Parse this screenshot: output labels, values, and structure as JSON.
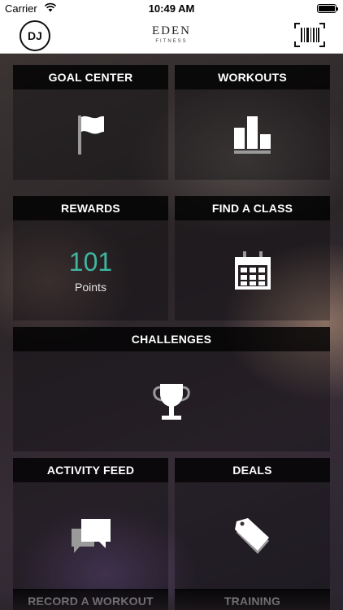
{
  "status_bar": {
    "carrier": "Carrier",
    "time": "10:49 AM"
  },
  "nav": {
    "avatar_initials": "DJ",
    "brand_name": "EDEN",
    "brand_subtitle": "FITNESS",
    "barcode_icon": "barcode-icon"
  },
  "tiles": {
    "goal_center": {
      "label": "GOAL CENTER",
      "icon": "flag-icon"
    },
    "workouts": {
      "label": "WORKOUTS",
      "icon": "bar-chart-icon"
    },
    "rewards": {
      "label": "REWARDS",
      "value": "101",
      "unit": "Points"
    },
    "find_class": {
      "label": "FIND A CLASS",
      "icon": "calendar-icon"
    },
    "challenges": {
      "label": "CHALLENGES",
      "icon": "trophy-icon"
    },
    "activity_feed": {
      "label": "ACTIVITY FEED",
      "icon": "chat-bubbles-icon"
    },
    "deals": {
      "label": "DEALS",
      "icon": "price-tag-icon"
    },
    "record_workout": {
      "label": "RECORD A WORKOUT"
    },
    "training": {
      "label": "TRAINING"
    }
  },
  "colors": {
    "accent_points": "#3fb5a1",
    "tile_header": "#000000",
    "icon": "#ffffff"
  }
}
